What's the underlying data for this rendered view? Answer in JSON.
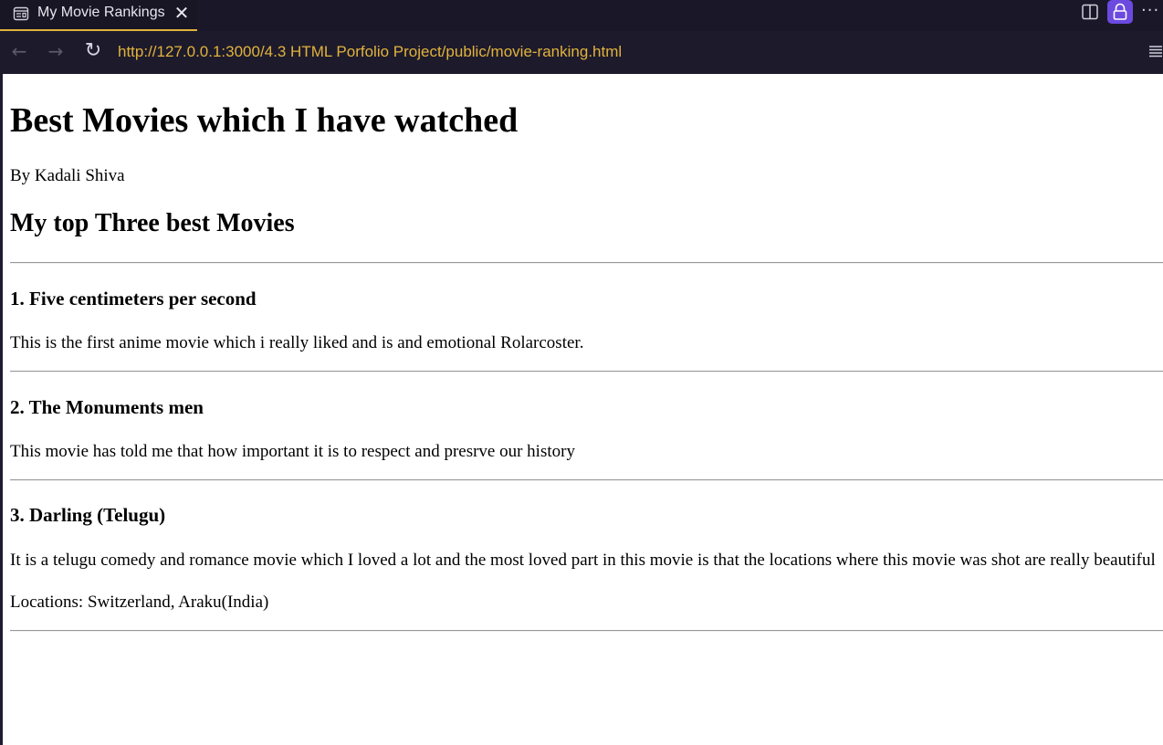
{
  "browser": {
    "tab_title": "My Movie Rankings",
    "url": "http://127.0.0.1:3000/4.3 HTML Porfolio Project/public/movie-ranking.html",
    "accent_color": "#e2b33b",
    "lock_button_color": "#6c4ae0",
    "icons": [
      "page-icon",
      "close-icon",
      "split-view-icon",
      "lock-icon",
      "more-icon",
      "back-arrow-icon",
      "forward-arrow-icon",
      "reload-icon",
      "menu-icon"
    ]
  },
  "page": {
    "heading": "Best Movies which I have watched",
    "byline": "By Kadali Shiva",
    "subheading": "My top Three best Movies",
    "movies": [
      {
        "title": "1. Five centimeters per second",
        "description": "This is the first anime movie which i really liked and is and emotional Rolarcoster."
      },
      {
        "title": "2. The Monuments men",
        "description": "This movie has told me that how important it is to respect and presrve our history"
      },
      {
        "title": "3. Darling (Telugu)",
        "description": "It is a telugu comedy and romance movie which I loved a lot and the most loved part in this movie is that the locations where this movie was shot are really beautiful",
        "locations": "Locations: Switzerland, Araku(India)"
      }
    ]
  }
}
